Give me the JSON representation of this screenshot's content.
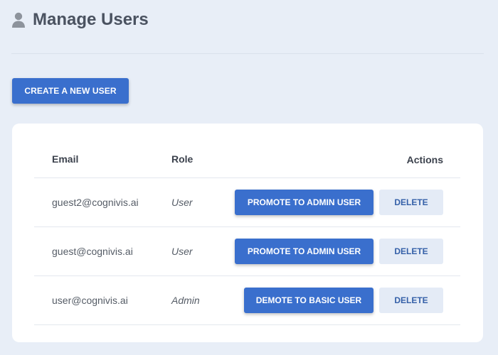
{
  "header": {
    "title": "Manage Users",
    "icon": "user-icon"
  },
  "toolbar": {
    "create_label": "CREATE A NEW USER"
  },
  "table": {
    "columns": {
      "email": "Email",
      "role": "Role",
      "actions": "Actions"
    },
    "rows": [
      {
        "email": "guest2@cognivis.ai",
        "role": "User",
        "action_label": "PROMOTE TO ADMIN USER",
        "delete_label": "DELETE"
      },
      {
        "email": "guest@cognivis.ai",
        "role": "User",
        "action_label": "PROMOTE TO ADMIN USER",
        "delete_label": "DELETE"
      },
      {
        "email": "user@cognivis.ai",
        "role": "Admin",
        "action_label": "DEMOTE TO BASIC USER",
        "delete_label": "DELETE"
      }
    ]
  },
  "colors": {
    "background": "#e8eef7",
    "primary": "#3a6fcd",
    "delete_bg": "#e4ebf6",
    "title": "#4a5260"
  }
}
